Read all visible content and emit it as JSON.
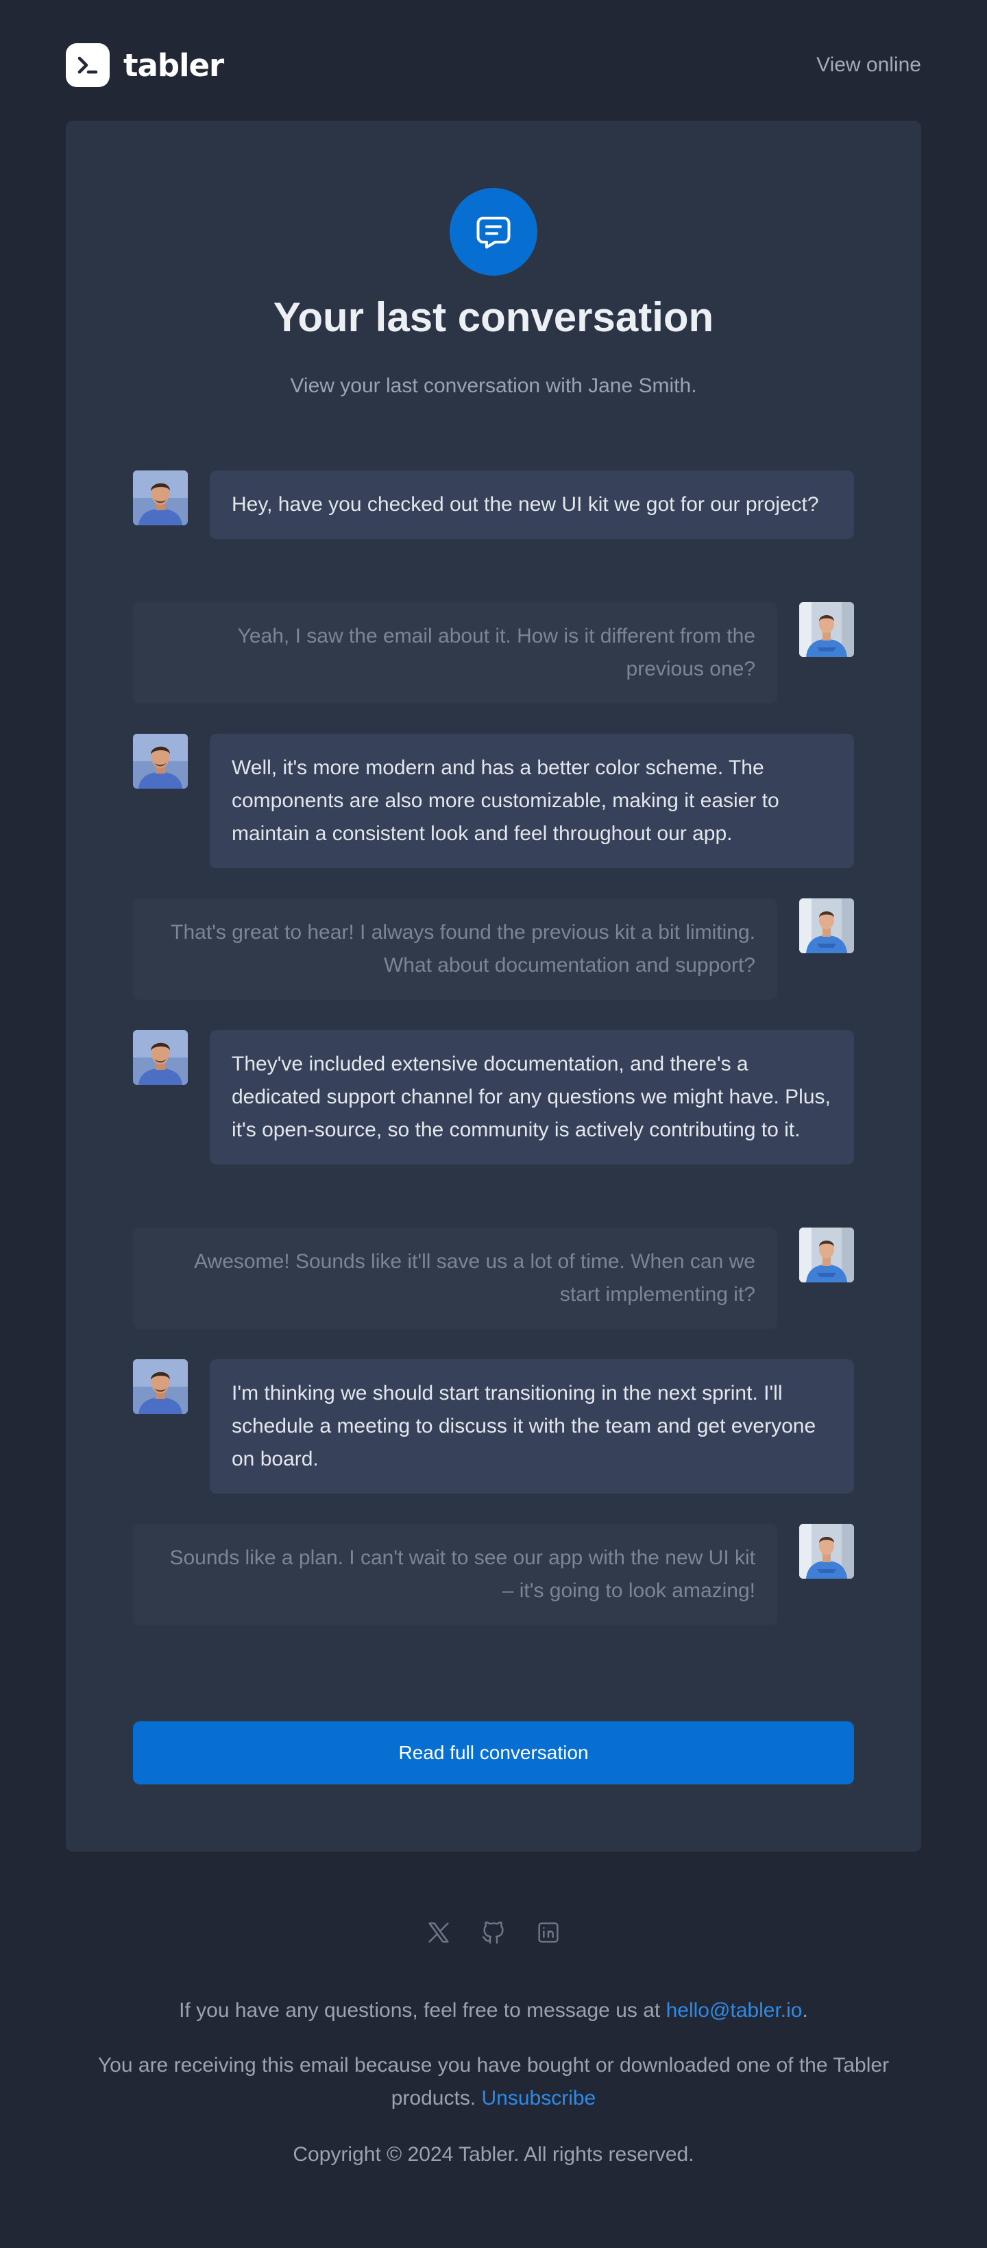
{
  "brand": {
    "name": "tabler"
  },
  "header": {
    "view_online": "View online"
  },
  "hero": {
    "icon": "message-icon",
    "title": "Your last conversation",
    "subtitle": "View your last conversation with Jane Smith."
  },
  "messages": [
    {
      "side": "left",
      "text": "Hey, have you checked out the new UI kit we got for our project?"
    },
    {
      "side": "right",
      "text": "Yeah, I saw the email about it. How is it different from the previous one?"
    },
    {
      "side": "left",
      "text": "Well, it's more modern and has a better color scheme. The components are also more customizable, making it easier to maintain a consistent look and feel throughout our app."
    },
    {
      "side": "right",
      "text": "That's great to hear! I always found the previous kit a bit limiting. What about documentation and support?"
    },
    {
      "side": "left",
      "text": "They've included extensive documentation, and there's a dedicated support channel for any questions we might have. Plus, it's open-source, so the community is actively contributing to it."
    },
    {
      "side": "right",
      "text": "Awesome! Sounds like it'll save us a lot of time. When can we start implementing it?"
    },
    {
      "side": "left",
      "text": "I'm thinking we should start transitioning in the next sprint. I'll schedule a meeting to discuss it with the team and get everyone on board."
    },
    {
      "side": "right",
      "text": "Sounds like a plan. I can't wait to see our app with the new UI kit – it's going to look amazing!"
    }
  ],
  "cta": {
    "label": "Read full conversation"
  },
  "footer": {
    "social_icons": [
      "x-icon",
      "github-icon",
      "linkedin-icon"
    ],
    "questions_text": "If you have any questions, feel free to message us at ",
    "email": "hello@tabler.io",
    "questions_end": ".",
    "receiving_text": "You are receiving this email because you have bought or downloaded one of the Tabler products. ",
    "unsubscribe": "Unsubscribe",
    "copyright": "Copyright © 2024 Tabler. All rights reserved."
  },
  "colors": {
    "background": "#222735",
    "card": "#2c3546",
    "primary": "#066fd1",
    "link": "#2f8ae6"
  }
}
